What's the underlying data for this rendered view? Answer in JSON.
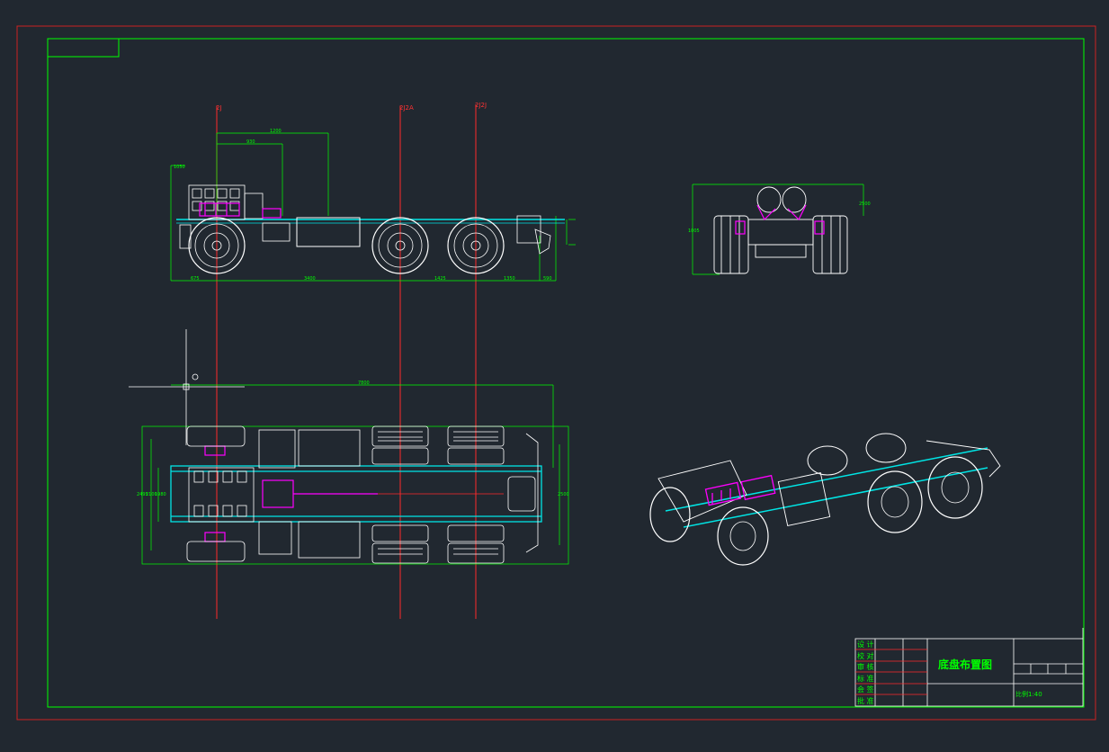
{
  "drawing": {
    "title": "底盘布置图",
    "scale_note": "比例1:40",
    "sign_rows": [
      "设 计",
      "校 对",
      "审 核",
      "标 准",
      "会 签",
      "批 准"
    ]
  },
  "axes": {
    "front_axle": "2J",
    "mid_axle": "2J2A",
    "rear_axle": "2J2J"
  },
  "dimensions": {
    "side_top": "1200",
    "side_inner": "930",
    "side_height": "1050",
    "side_bottom": [
      "675",
      "3400",
      "1425",
      "1350",
      "590"
    ],
    "plan_overall": "7800",
    "plan_track": [
      "2495",
      "2100",
      "1980",
      "2500"
    ],
    "front_width": "2500",
    "front_height": "1005"
  },
  "colors": {
    "background": "#212830",
    "outer_frame": "#cc2222",
    "inner_frame": "#00ff00",
    "axis_line": "#ff2a2a",
    "outline": "#ffffff",
    "frame_rail": "#00e5e5",
    "powertrain": "#ff00ff"
  }
}
